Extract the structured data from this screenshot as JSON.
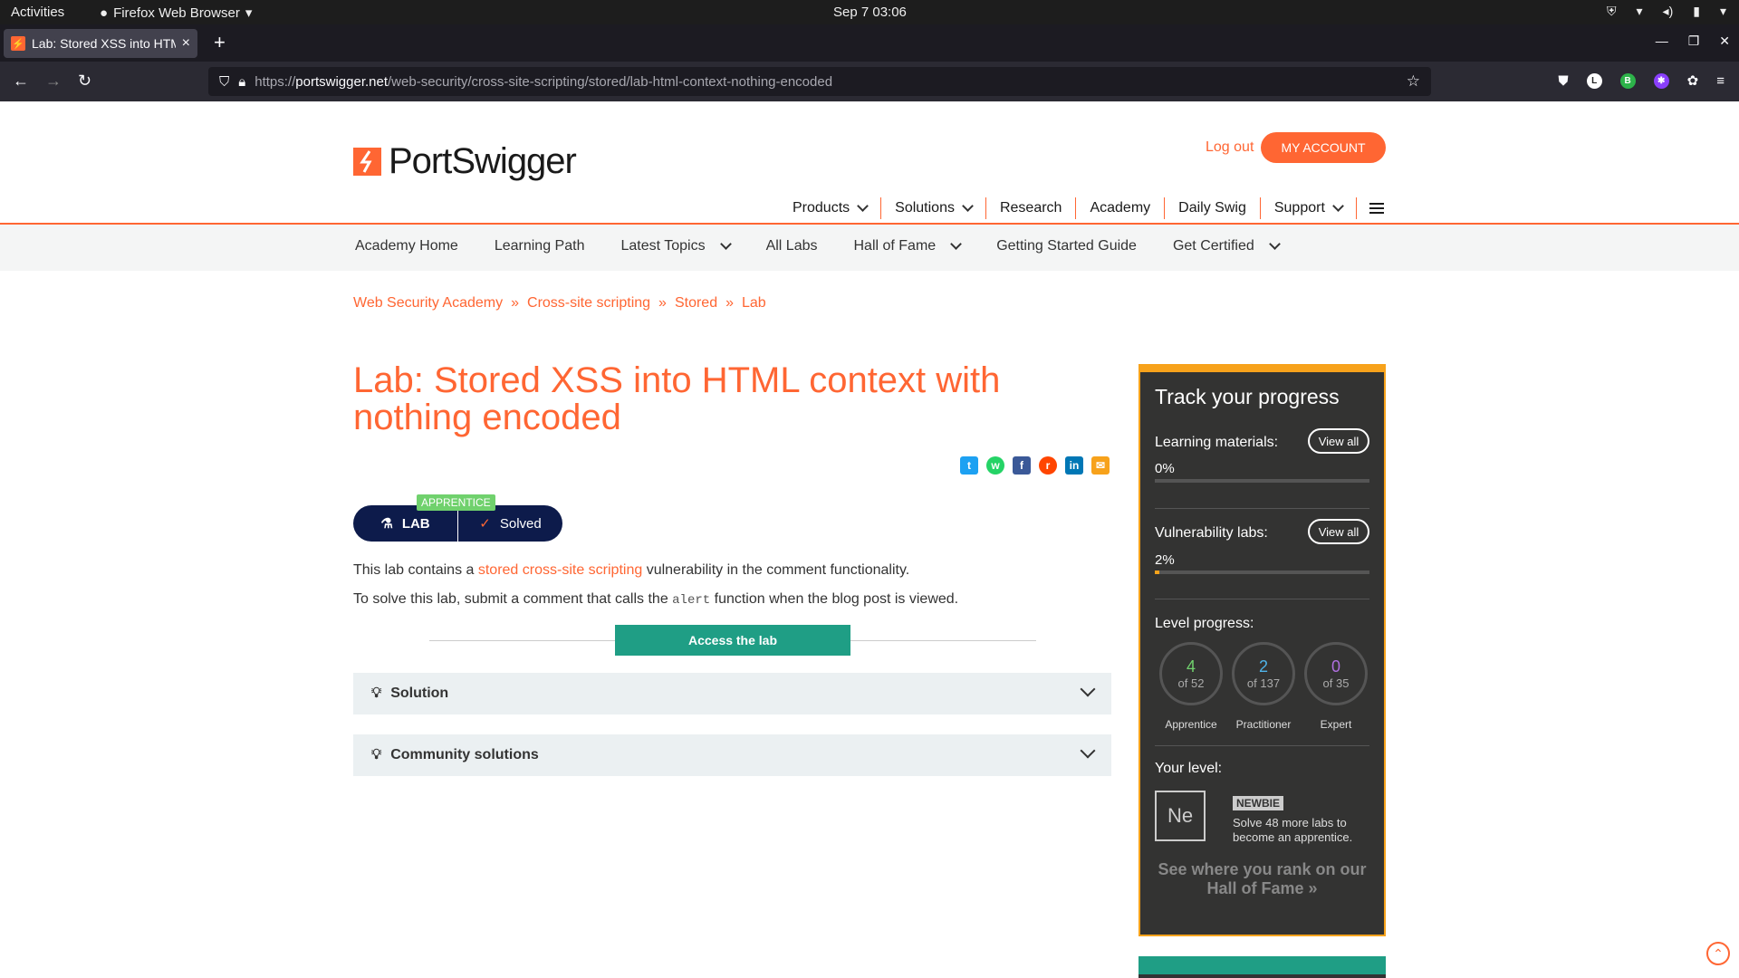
{
  "system": {
    "activities": "Activities",
    "app_name": "Firefox Web Browser",
    "clock": "Sep 7  03:06"
  },
  "browser": {
    "tab_title": "Lab: Stored XSS into HTM",
    "url_scheme": "https://",
    "url_host": "portswigger.net",
    "url_path": "/web-security/cross-site-scripting/stored/lab-html-context-nothing-encoded"
  },
  "header": {
    "logo_text": "PortSwigger",
    "logout": "Log out",
    "my_account": "MY ACCOUNT",
    "nav": [
      "Products",
      "Solutions",
      "Research",
      "Academy",
      "Daily Swig",
      "Support"
    ]
  },
  "subnav": {
    "items": [
      "Academy Home",
      "Learning Path",
      "Latest Topics",
      "All Labs",
      "Hall of Fame",
      "Getting Started Guide",
      "Get Certified"
    ]
  },
  "breadcrumb": [
    "Web Security Academy",
    "Cross-site scripting",
    "Stored",
    "Lab"
  ],
  "lab": {
    "title": "Lab: Stored XSS into HTML context with nothing encoded",
    "level_tag": "APPRENTICE",
    "lab_label": "LAB",
    "status": "Solved",
    "desc1_pre": "This lab contains a ",
    "desc1_link": "stored cross-site scripting",
    "desc1_post": " vulnerability in the comment functionality.",
    "desc2_pre": "To solve this lab, submit a comment that calls the ",
    "desc2_code": "alert",
    "desc2_post": " function when the blog post is viewed.",
    "access_button": "Access the lab",
    "accordions": [
      "Solution",
      "Community solutions"
    ]
  },
  "progress": {
    "title": "Track your progress",
    "learning_label": "Learning materials:",
    "learning_pct": "0%",
    "learning_value": 0,
    "view_all": "View all",
    "vuln_label": "Vulnerability labs:",
    "vuln_pct": "2%",
    "vuln_value": 2,
    "level_label": "Level progress:",
    "levels": [
      {
        "num": "4",
        "of": "of 52",
        "name": "Apprentice",
        "color": "#70d16d"
      },
      {
        "num": "2",
        "of": "of 137",
        "name": "Practitioner",
        "color": "#4fb3e8"
      },
      {
        "num": "0",
        "of": "of 35",
        "name": "Expert",
        "color": "#b06fe0"
      }
    ],
    "your_level_label": "Your level:",
    "level_symbol": "Ne",
    "level_name": "NEWBIE",
    "level_text": "Solve 48 more labs to become an apprentice.",
    "rank_text": "See where you rank on our Hall of Fame"
  },
  "colors": {
    "accent": "#ff6633",
    "teal": "#1f9e85",
    "navy": "#0d1b4b",
    "sidebar_border": "#f7a21b"
  }
}
